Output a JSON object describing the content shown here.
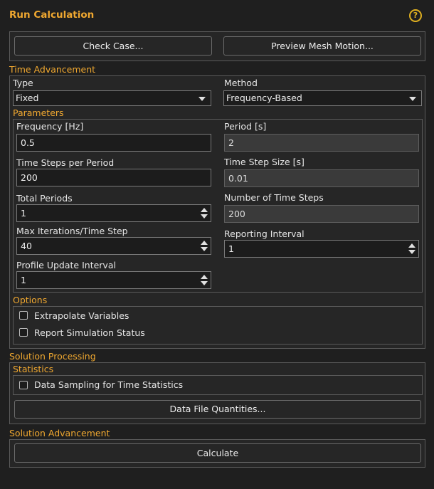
{
  "panel": {
    "title": "Run Calculation",
    "help_glyph": "?"
  },
  "top_buttons": {
    "check_case": "Check Case...",
    "preview_mesh": "Preview Mesh Motion..."
  },
  "time_advancement": {
    "label": "Time Advancement",
    "type_label": "Type",
    "type_value": "Fixed",
    "method_label": "Method",
    "method_value": "Frequency-Based"
  },
  "parameters": {
    "label": "Parameters",
    "frequency": {
      "label": "Frequency [Hz]",
      "value": "0.5"
    },
    "period": {
      "label": "Period [s]",
      "value": "2"
    },
    "steps_per_period": {
      "label": "Time Steps per Period",
      "value": "200"
    },
    "time_step_size": {
      "label": "Time Step Size [s]",
      "value": "0.01"
    },
    "total_periods": {
      "label": "Total Periods",
      "value": "1"
    },
    "num_time_steps": {
      "label": "Number of Time Steps",
      "value": "200"
    },
    "max_iterations": {
      "label": "Max Iterations/Time Step",
      "value": "40"
    },
    "reporting_interval": {
      "label": "Reporting Interval",
      "value": "1"
    },
    "profile_update": {
      "label": "Profile Update Interval",
      "value": "1"
    }
  },
  "options": {
    "label": "Options",
    "extrapolate": "Extrapolate Variables",
    "report_status": "Report Simulation Status"
  },
  "solution_processing": {
    "label": "Solution Processing",
    "statistics_label": "Statistics",
    "data_sampling": "Data Sampling for Time Statistics",
    "data_file_btn": "Data File Quantities..."
  },
  "solution_advancement": {
    "label": "Solution Advancement",
    "calculate_btn": "Calculate"
  },
  "colors": {
    "accent": "#f0a830",
    "background": "#1f1f1f",
    "help": "#e0b020"
  }
}
